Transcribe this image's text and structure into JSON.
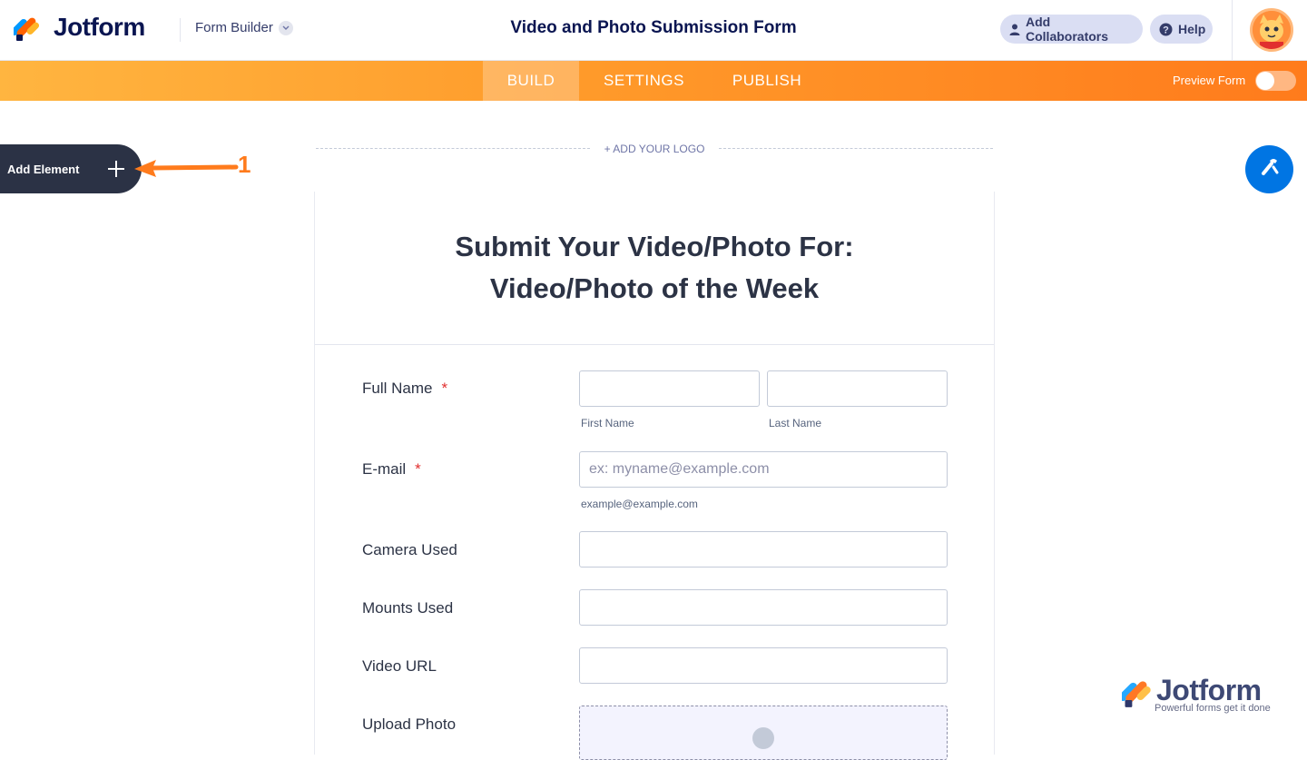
{
  "header": {
    "brand": "Jotform",
    "builder_menu": "Form Builder",
    "form_title": "Video and Photo Submission Form",
    "add_collaborators": "Add Collaborators",
    "help": "Help"
  },
  "nav": {
    "tabs": [
      "BUILD",
      "SETTINGS",
      "PUBLISH"
    ],
    "active_tab": "BUILD",
    "preview_label": "Preview Form",
    "preview_on": false
  },
  "sidebar": {
    "add_element": "Add Element",
    "annotation": "1"
  },
  "logo_area": {
    "add_logo": "+ ADD YOUR LOGO"
  },
  "form": {
    "heading_line1": "Submit Your Video/Photo For:",
    "heading_line2": "Video/Photo of the Week",
    "required_mark": "*",
    "fields": {
      "full_name": {
        "label": "Full Name",
        "first_sublabel": "First Name",
        "last_sublabel": "Last Name"
      },
      "email": {
        "label": "E-mail",
        "placeholder": "ex: myname@example.com",
        "sublabel": "example@example.com"
      },
      "camera": {
        "label": "Camera Used"
      },
      "mounts": {
        "label": "Mounts Used"
      },
      "video_url": {
        "label": "Video URL"
      },
      "upload": {
        "label": "Upload Photo"
      }
    }
  },
  "watermark": {
    "brand": "Jotform",
    "tagline": "Powerful forms get it done"
  },
  "colors": {
    "accent_orange": "#ff7b1c",
    "navy": "#0a1551",
    "required": "#e12f2f",
    "wand_blue": "#0075e3"
  }
}
